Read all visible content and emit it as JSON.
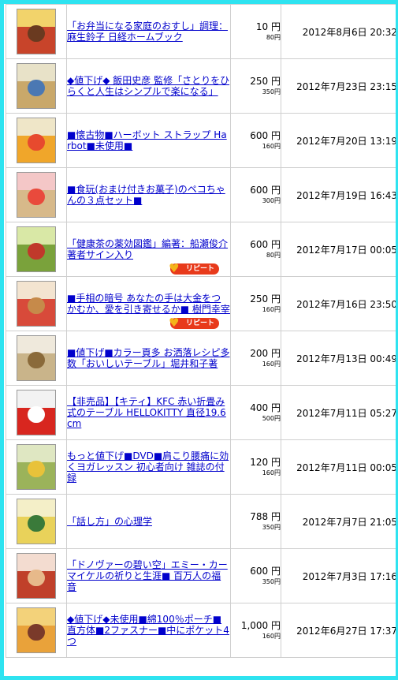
{
  "listings": [
    {
      "title": "「お弁当になる家庭のおすし」調理：麻生鈴子 日経ホームブック",
      "price": "10 円",
      "start_price": "80円",
      "date": "2012年8月6日 20:32",
      "repeat": false,
      "thumb_colors": [
        "#f2d36b",
        "#c8442a",
        "#6a3a20"
      ]
    },
    {
      "title": "◆値下げ◆ 飯田史彦 監修「さとりをひらくと人生はシンプルで楽になる」",
      "price": "250 円",
      "start_price": "350円",
      "date": "2012年7月23日 23:15",
      "repeat": false,
      "thumb_colors": [
        "#e8e2c8",
        "#c9a86a",
        "#4b78b3"
      ]
    },
    {
      "title": "■懐古物■ハーボット ストラップ Harbot■未使用■",
      "price": "600 円",
      "start_price": "160円",
      "date": "2012年7月20日 13:19",
      "repeat": false,
      "thumb_colors": [
        "#efe6c8",
        "#f0a62a",
        "#e74a2e"
      ]
    },
    {
      "title": "■食玩(おまけ付きお菓子)のペコちゃんの３点セット■",
      "price": "600 円",
      "start_price": "300円",
      "date": "2012年7月19日 16:43",
      "repeat": false,
      "thumb_colors": [
        "#f4c7c7",
        "#d7b98a",
        "#e94a3c"
      ]
    },
    {
      "title": "「健康茶の薬効図鑑」編著：船瀬俊介 著者サイン入り",
      "price": "600 円",
      "start_price": "80円",
      "date": "2012年7月17日 00:05",
      "repeat": true,
      "repeat_label": "リピート",
      "thumb_colors": [
        "#d9e8a6",
        "#7aa23b",
        "#c0392b"
      ]
    },
    {
      "title": "■手相の暗号 あなたの手は大金をつかむか、愛を引き寄せるか■ 樹門幸宰",
      "price": "250 円",
      "start_price": "160円",
      "date": "2012年7月16日 23:50",
      "repeat": true,
      "repeat_label": "リピート",
      "thumb_colors": [
        "#f3e4d0",
        "#d84a3a",
        "#c68a4a"
      ]
    },
    {
      "title": "■値下げ■カラー頁多 お洒落レシピ多数「おいしいテーブル」堀井和子著",
      "price": "200 円",
      "start_price": "160円",
      "date": "2012年7月13日 00:49",
      "repeat": false,
      "thumb_colors": [
        "#efe9dc",
        "#c9b48a",
        "#8a6a3a"
      ]
    },
    {
      "title": "【非売品】【キティ】KFC 赤い折畳み式のテーブル HELLOKITTY 直径19.6cm",
      "price": "400 円",
      "start_price": "500円",
      "date": "2012年7月11日 05:27",
      "repeat": false,
      "thumb_colors": [
        "#f2f2f2",
        "#d8261f",
        "#ffffff"
      ]
    },
    {
      "title": "もっと値下げ■DVD■肩こり腰痛に効くヨガレッスン 初心者向け 雑誌の付録",
      "price": "120 円",
      "start_price": "160円",
      "date": "2012年7月11日 00:05",
      "repeat": false,
      "thumb_colors": [
        "#dfe7c2",
        "#9bb35a",
        "#e8c23a"
      ]
    },
    {
      "title": "「話し方」の心理学",
      "price": "788 円",
      "start_price": "350円",
      "date": "2012年7月7日 21:05",
      "repeat": false,
      "thumb_colors": [
        "#f4efc8",
        "#e9d25a",
        "#3a7a3a"
      ]
    },
    {
      "title": "「ドノヴァーの碧い空」エミー・カーマイケルの祈りと生涯■ 百万人の福音",
      "price": "600 円",
      "start_price": "350円",
      "date": "2012年7月3日 17:16",
      "repeat": false,
      "thumb_colors": [
        "#f3dcd0",
        "#c0402a",
        "#e7b98a"
      ]
    },
    {
      "title": "◆値下げ◆未使用■綿100％ポーチ■直方体■2ファスナー■中にポケット4つ",
      "price": "1,000 円",
      "start_price": "160円",
      "date": "2012年6月27日 17:37",
      "repeat": false,
      "thumb_colors": [
        "#f3d27a",
        "#e9a23a",
        "#7a3a2a"
      ]
    }
  ]
}
